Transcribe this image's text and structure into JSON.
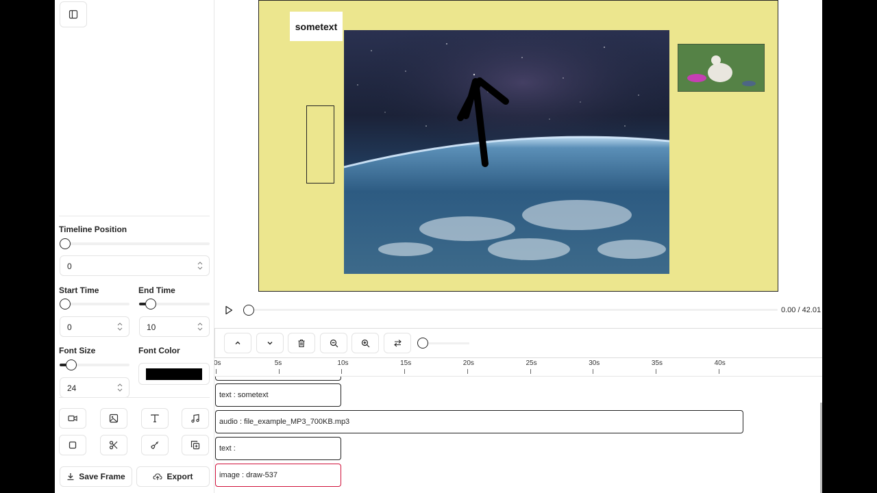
{
  "sidebar": {
    "timeline_position": {
      "label": "Timeline Position",
      "value": "0",
      "level": 0
    },
    "start_time": {
      "label": "Start Time",
      "value": "0",
      "level": 0
    },
    "end_time": {
      "label": "End Time",
      "value": "10",
      "level": 0.24
    },
    "font_size": {
      "label": "Font Size",
      "value": "24",
      "level": 0.2
    },
    "font_color": {
      "label": "Font Color",
      "value": "#000000"
    },
    "tools": [
      "video-icon",
      "image-icon",
      "text-icon",
      "music-icon",
      "square-icon",
      "scissors-icon",
      "brush-icon",
      "duplicate-icon"
    ],
    "save_frame_label": "Save Frame",
    "export_label": "Export"
  },
  "canvas": {
    "text_element": "sometext",
    "background_color": "#ece68e"
  },
  "player": {
    "time": "0.00 / 42.01",
    "progress": 0
  },
  "timeline": {
    "ruler_labels": [
      "0s",
      "5s",
      "10s",
      "15s",
      "20s",
      "25s",
      "30s",
      "35s",
      "40s"
    ],
    "clips": [
      {
        "label": "text : sometext",
        "start": 0,
        "end": 10
      },
      {
        "label": "audio : file_example_MP3_700KB.mp3",
        "start": 0,
        "end": 42.01
      },
      {
        "label": "text :",
        "start": 0,
        "end": 10
      },
      {
        "label": "image : draw-537",
        "start": 0,
        "end": 10,
        "selected": true
      }
    ]
  }
}
